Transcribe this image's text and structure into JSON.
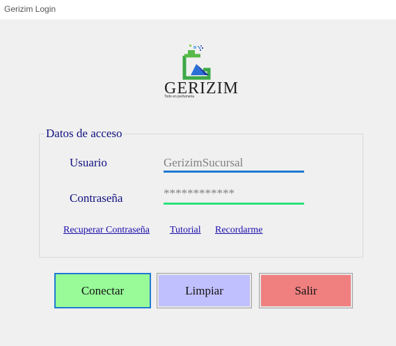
{
  "window": {
    "title": "Gerizim Login"
  },
  "logo": {
    "brand": "GERIZIM",
    "tagline": "Todo en perfumeria"
  },
  "access": {
    "legend": "Datos de acceso",
    "user_label": "Usuario",
    "user_value": "GerizimSucursal",
    "password_label": "Contraseña",
    "password_value": "************"
  },
  "links": {
    "recover": "Recuperar Contraseña",
    "tutorial": "Tutorial",
    "remember": "Recordarme"
  },
  "buttons": {
    "connect": "Conectar",
    "clear": "Limpiar",
    "exit": "Salir"
  },
  "colors": {
    "user_underline": "#1f78d1",
    "password_underline": "#2be07a",
    "connect_bg": "#98fb98",
    "connect_border": "#1f78d1",
    "clear_bg": "#c0c0ff",
    "exit_bg": "#f08080",
    "label_color": "#101080",
    "link_color": "#1a0dab"
  },
  "icons": {
    "logo": "perfume-bottle-logo-icon"
  }
}
